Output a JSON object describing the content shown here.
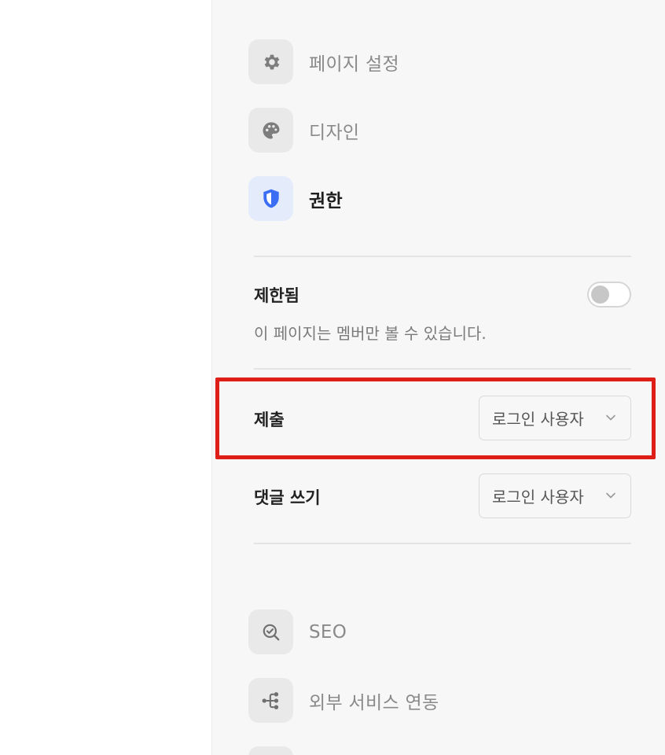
{
  "menu": {
    "page_settings": {
      "label": "페이지 설정",
      "icon": "gear-icon"
    },
    "design": {
      "label": "디자인",
      "icon": "palette-icon"
    },
    "permissions": {
      "label": "권한",
      "icon": "shield-icon",
      "active": true,
      "accent": "#3b6ef5"
    },
    "seo": {
      "label": "SEO",
      "icon": "seo-search-icon"
    },
    "integrations": {
      "label": "외부 서비스 연동",
      "icon": "integration-icon"
    }
  },
  "restricted": {
    "title": "제한됨",
    "description": "이 페이지는 멤버만 볼 수 있습니다.",
    "enabled": false
  },
  "submit": {
    "label": "제출",
    "value": "로그인 사용자"
  },
  "comment": {
    "label": "댓글 쓰기",
    "value": "로그인 사용자"
  },
  "colors": {
    "highlight": "#dd1f17",
    "accent": "#3b6ef5"
  }
}
